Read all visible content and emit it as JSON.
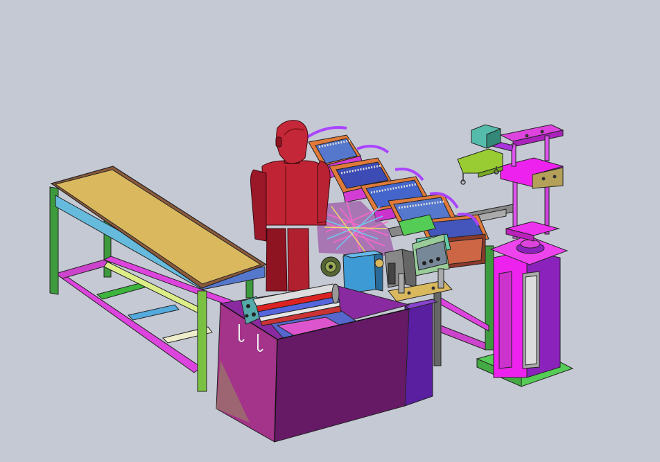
{
  "scene": {
    "type": "cad-assembly-render",
    "background_color": "#c5c9d3",
    "objects": [
      {
        "name": "workbench",
        "top_color": "#d9b85e",
        "frame_colors": [
          "#cc44cc",
          "#3d9b3d",
          "#55aadd",
          "#dddd88",
          "#9999ff"
        ]
      },
      {
        "name": "human-mannequin",
        "color": "#b0202e"
      },
      {
        "name": "feeder-trays",
        "colors": [
          "#e07a3a",
          "#5577cc",
          "#dd33cc",
          "#55cc55"
        ]
      },
      {
        "name": "roller-assembly",
        "colors": [
          "#cccccc",
          "#dd2222",
          "#5566dd"
        ]
      },
      {
        "name": "main-cabinet",
        "colors": [
          "#661a66",
          "#8822aa",
          "#a4338a"
        ]
      },
      {
        "name": "press-tower",
        "colors": [
          "#ee22ee",
          "#8b22bb",
          "#66aa44"
        ]
      },
      {
        "name": "hanging-bracket",
        "color": "#99cc33"
      }
    ]
  }
}
